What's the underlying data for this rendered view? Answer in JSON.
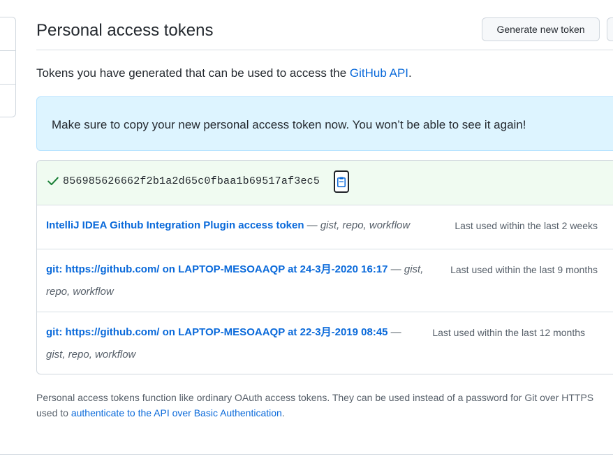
{
  "header": {
    "title": "Personal access tokens",
    "generate_button": "Generate new token"
  },
  "subhead": {
    "prefix": "Tokens you have generated that can be used to access the ",
    "link": "GitHub API",
    "suffix": "."
  },
  "flash": {
    "message": "Make sure to copy your new personal access token now. You won’t be able to see it again!"
  },
  "new_token": {
    "value": "856985626662f2b1a2d65c0fbaa1b69517af3ec5",
    "status_color": "#1a7f37"
  },
  "tokens": [
    {
      "name": "IntelliJ IDEA Github Integration Plugin access token",
      "separator": " — ",
      "scopes_line1": "gist, repo, workflow",
      "scopes_line2": "",
      "last_used": "Last used within the last 2 weeks"
    },
    {
      "name": "git: https://github.com/ on LAPTOP-MESOAAQP at 24-3月-2020 16:17",
      "separator": " — ",
      "scopes_line1": "gist,",
      "scopes_line2": "repo, workflow",
      "last_used": "Last used within the last 9 months"
    },
    {
      "name": "git: https://github.com/ on LAPTOP-MESOAAQP at 22-3月-2019 08:45",
      "separator": " —",
      "scopes_line1": "",
      "scopes_line2": "gist, repo, workflow",
      "last_used": "Last used within the last 12 months"
    }
  ],
  "footer": {
    "line1": "Personal access tokens function like ordinary OAuth access tokens. They can be used instead of a password for Git over HTTPS",
    "line2_prefix": "used to ",
    "line2_link": "authenticate to the API over Basic Authentication",
    "line2_suffix": "."
  },
  "colors": {
    "link": "#0969da",
    "flash_bg": "#ddf4ff",
    "new_token_bg": "#f0fbf1"
  }
}
